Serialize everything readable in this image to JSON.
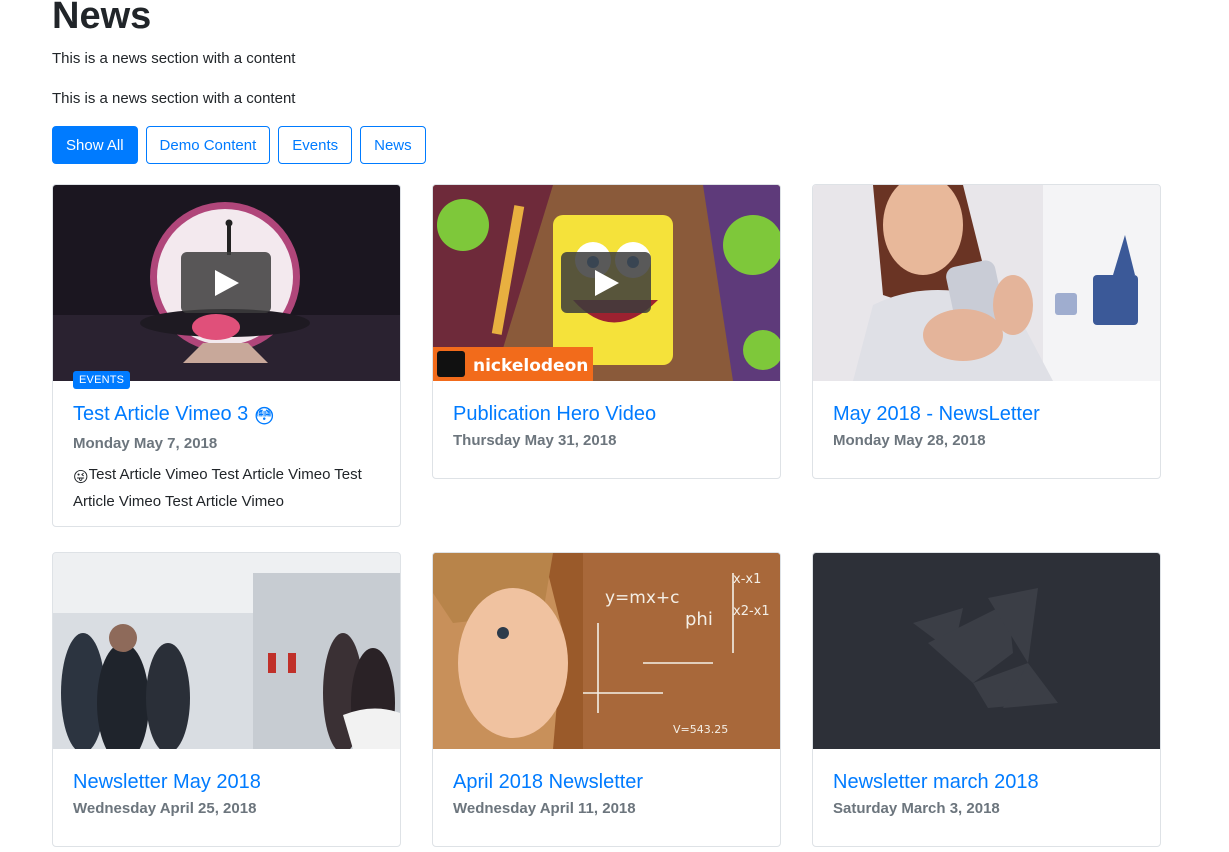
{
  "page": {
    "title": "News",
    "intro": [
      "This is a news section with a content",
      "This is a news section with a content"
    ]
  },
  "filters": [
    {
      "label": "Show All",
      "active": true
    },
    {
      "label": "Demo Content",
      "active": false
    },
    {
      "label": "Events",
      "active": false
    },
    {
      "label": "News",
      "active": false
    }
  ],
  "cards": [
    {
      "title": "Test Article Vimeo 3",
      "title_emoji": "😳",
      "date": "Monday May 7, 2018",
      "badge": "EVENTS",
      "text": "Test Article Vimeo Test Article Vimeo Test Article Vimeo Test Article Vimeo",
      "text_emoji": "😜",
      "video": true,
      "image": "stage-performance-video-thumbnail"
    },
    {
      "title": "Publication Hero Video",
      "date": "Thursday May 31, 2018",
      "video": true,
      "image": "cartoon-video-thumbnail",
      "logo_text": "nickelodeon"
    },
    {
      "title": "May 2018 - NewsLetter",
      "date": "Monday May 28, 2018",
      "image": "smartphone-likes-photo"
    },
    {
      "title": "Newsletter May 2018",
      "date": "Wednesday April 25, 2018",
      "image": "event-crowd-photo"
    },
    {
      "title": "April 2018 Newsletter",
      "date": "Wednesday April 11, 2018",
      "image": "chalkboard-math-photo",
      "chalk_text": [
        "y=mx+c",
        "phi",
        "x-x1",
        "x2-x1",
        "V=543.25"
      ]
    },
    {
      "title": "Newsletter march 2018",
      "date": "Saturday March 3, 2018",
      "image": "placeholder-bird-logo"
    }
  ],
  "colors": {
    "primary": "#007bff",
    "muted": "#6c757d",
    "border": "#dee2e6"
  }
}
